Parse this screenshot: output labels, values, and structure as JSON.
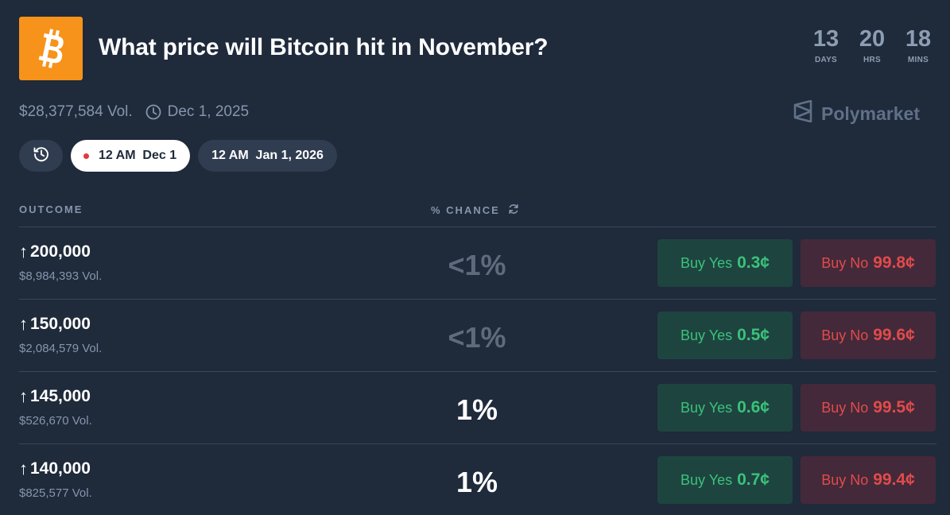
{
  "header": {
    "title": "What price will Bitcoin hit in November?",
    "logo_icon": "bitcoin-logo",
    "logo_color": "#f7931a",
    "countdown": [
      {
        "value": "13",
        "label": "DAYS"
      },
      {
        "value": "20",
        "label": "HRS"
      },
      {
        "value": "18",
        "label": "MINS"
      }
    ]
  },
  "meta": {
    "volume": "$28,377,584 Vol.",
    "date": "Dec 1, 2025",
    "clock_icon": "clock-icon"
  },
  "brand": {
    "name": "Polymarket",
    "icon": "polymarket-logo-icon"
  },
  "filters": {
    "history_icon": "history-icon",
    "active": {
      "time": "12 AM",
      "date": "Dec 1"
    },
    "next": {
      "time": "12 AM",
      "date": "Jan 1, 2026"
    }
  },
  "table": {
    "headers": {
      "outcome": "OUTCOME",
      "chance": "% CHANCE"
    },
    "rows": [
      {
        "outcome": "200,000",
        "volume": "$8,984,393 Vol.",
        "chance": "<1%",
        "yes_label": "Buy Yes",
        "yes_price": "0.3¢",
        "no_label": "Buy No",
        "no_price": "99.8¢"
      },
      {
        "outcome": "150,000",
        "volume": "$2,084,579 Vol.",
        "chance": "<1%",
        "yes_label": "Buy Yes",
        "yes_price": "0.5¢",
        "no_label": "Buy No",
        "no_price": "99.6¢"
      },
      {
        "outcome": "145,000",
        "volume": "$526,670 Vol.",
        "chance": "1%",
        "yes_label": "Buy Yes",
        "yes_price": "0.6¢",
        "no_label": "Buy No",
        "no_price": "99.5¢"
      },
      {
        "outcome": "140,000",
        "volume": "$825,577 Vol.",
        "chance": "1%",
        "yes_label": "Buy Yes",
        "yes_price": "0.7¢",
        "no_label": "Buy No",
        "no_price": "99.4¢"
      }
    ]
  },
  "colors": {
    "background": "#1f2a3b",
    "yes_text": "#3bc27a",
    "yes_bg": "#1e4440",
    "no_text": "#e14b4b",
    "no_bg": "#44293a",
    "muted": "#8596ad"
  }
}
